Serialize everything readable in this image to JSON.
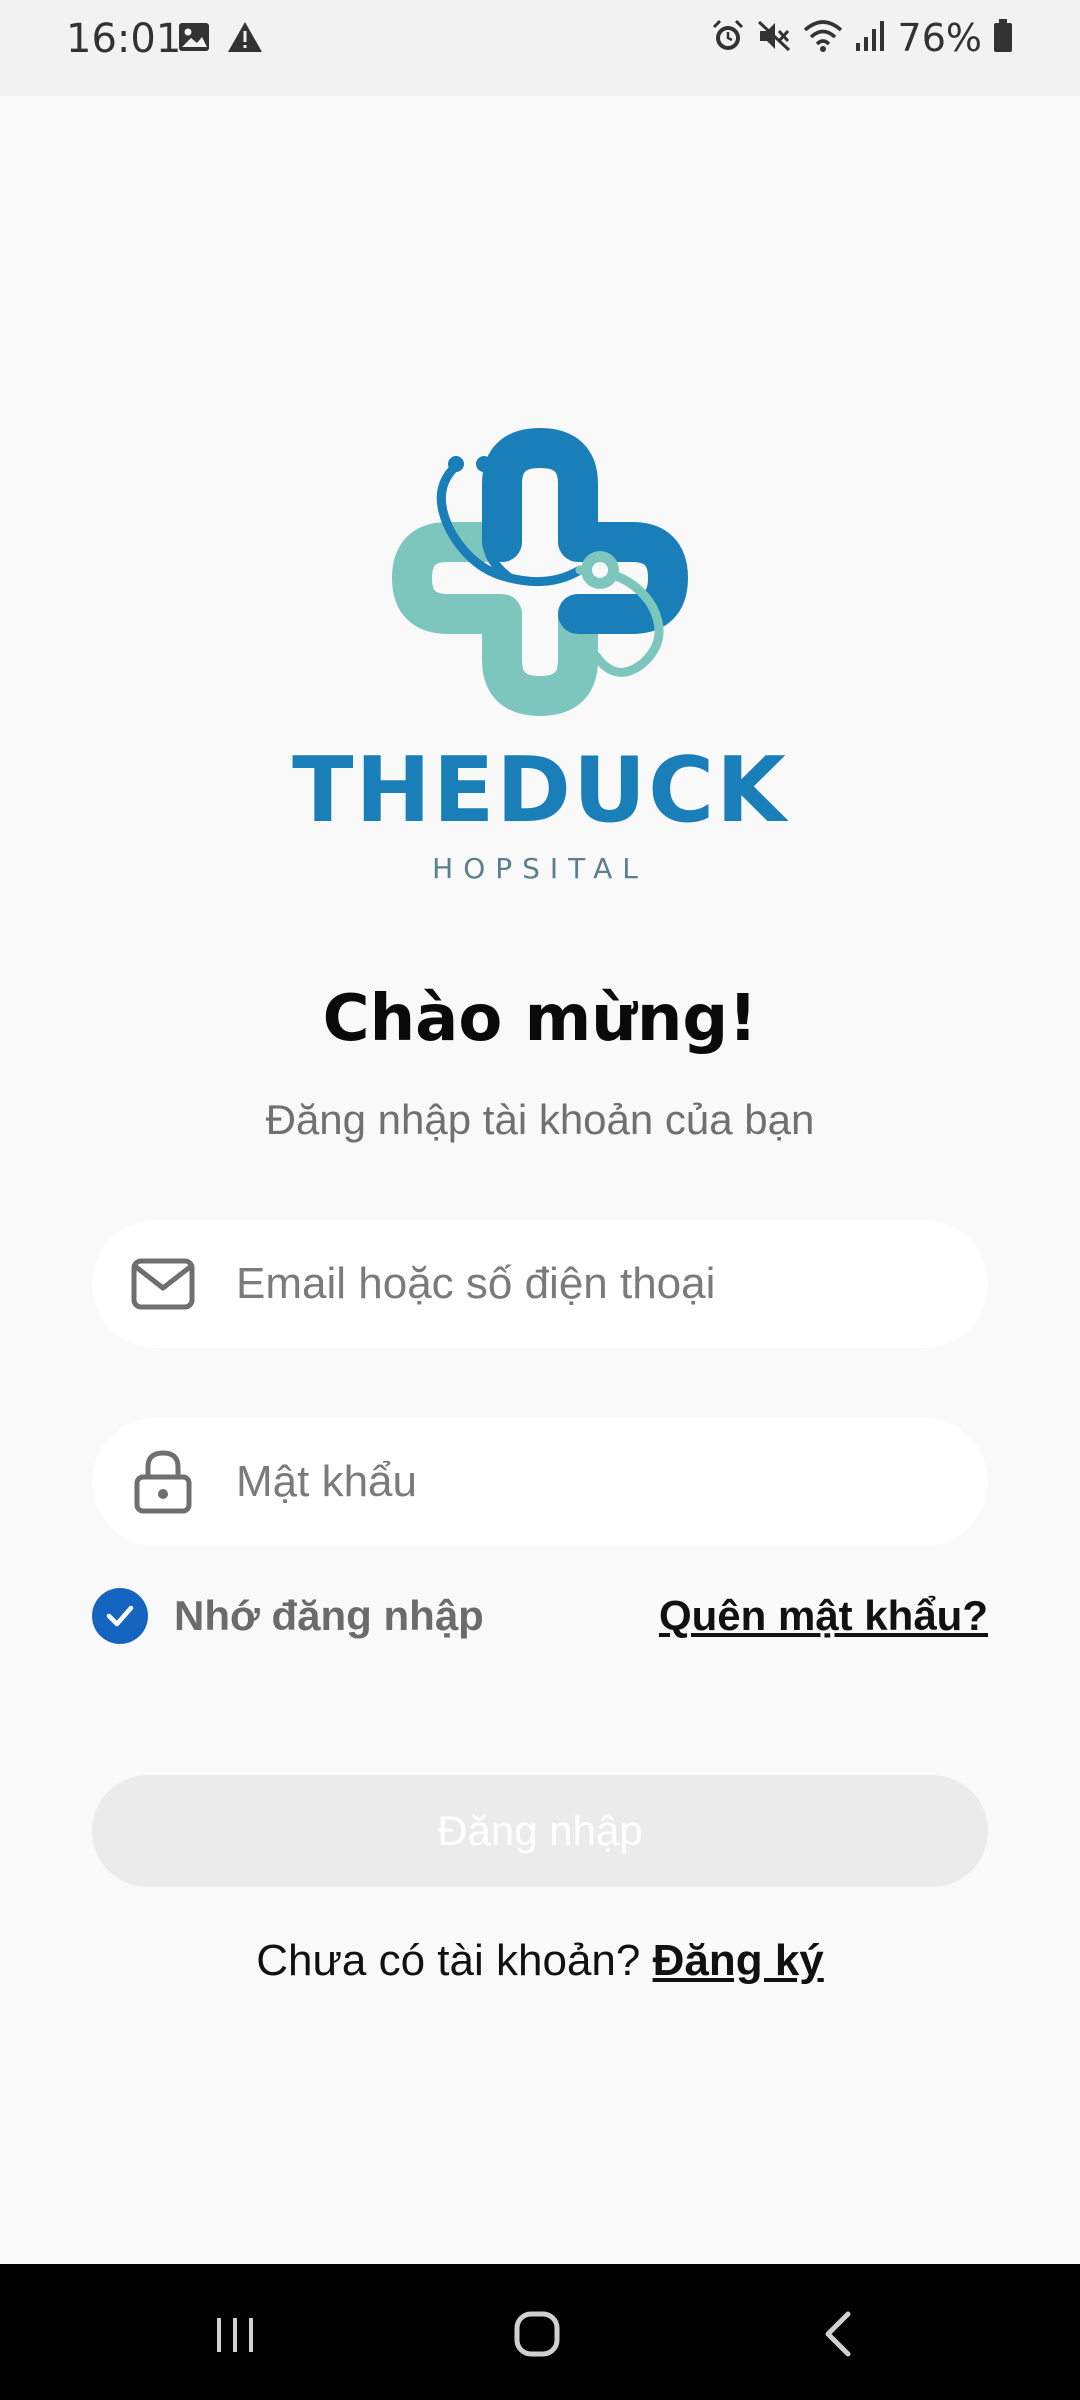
{
  "status_bar": {
    "time": "16:01",
    "battery": "76%",
    "icons_left": [
      "image-icon",
      "warning-icon"
    ],
    "icons_right": [
      "alarm-icon",
      "mute-icon",
      "wifi-icon",
      "signal-icon",
      "battery-icon"
    ]
  },
  "logo": {
    "brand": "THEDUCK",
    "subtitle": "HOPSITAL",
    "colors": {
      "blue": "#1a7fb8",
      "teal": "#7cc6be"
    }
  },
  "welcome": {
    "title": "Chào mừng!",
    "subtitle": "Đăng nhập tài khoản của bạn"
  },
  "form": {
    "email_placeholder": "Email hoặc số điện thoại",
    "email_value": "",
    "password_placeholder": "Mật khẩu",
    "password_value": "",
    "remember_label": "Nhớ đăng nhập",
    "remember_checked": true,
    "forgot_label": "Quên mật khẩu?",
    "login_label": "Đăng nhập"
  },
  "signup": {
    "prompt": "Chưa có tài khoản? ",
    "link_label": "Đăng ký"
  },
  "nav": {
    "buttons": [
      "recent-apps-icon",
      "home-icon",
      "back-icon"
    ]
  },
  "colors": {
    "accent": "#1565c0",
    "background": "#f9f9f9",
    "button_disabled": "#ebebec"
  }
}
